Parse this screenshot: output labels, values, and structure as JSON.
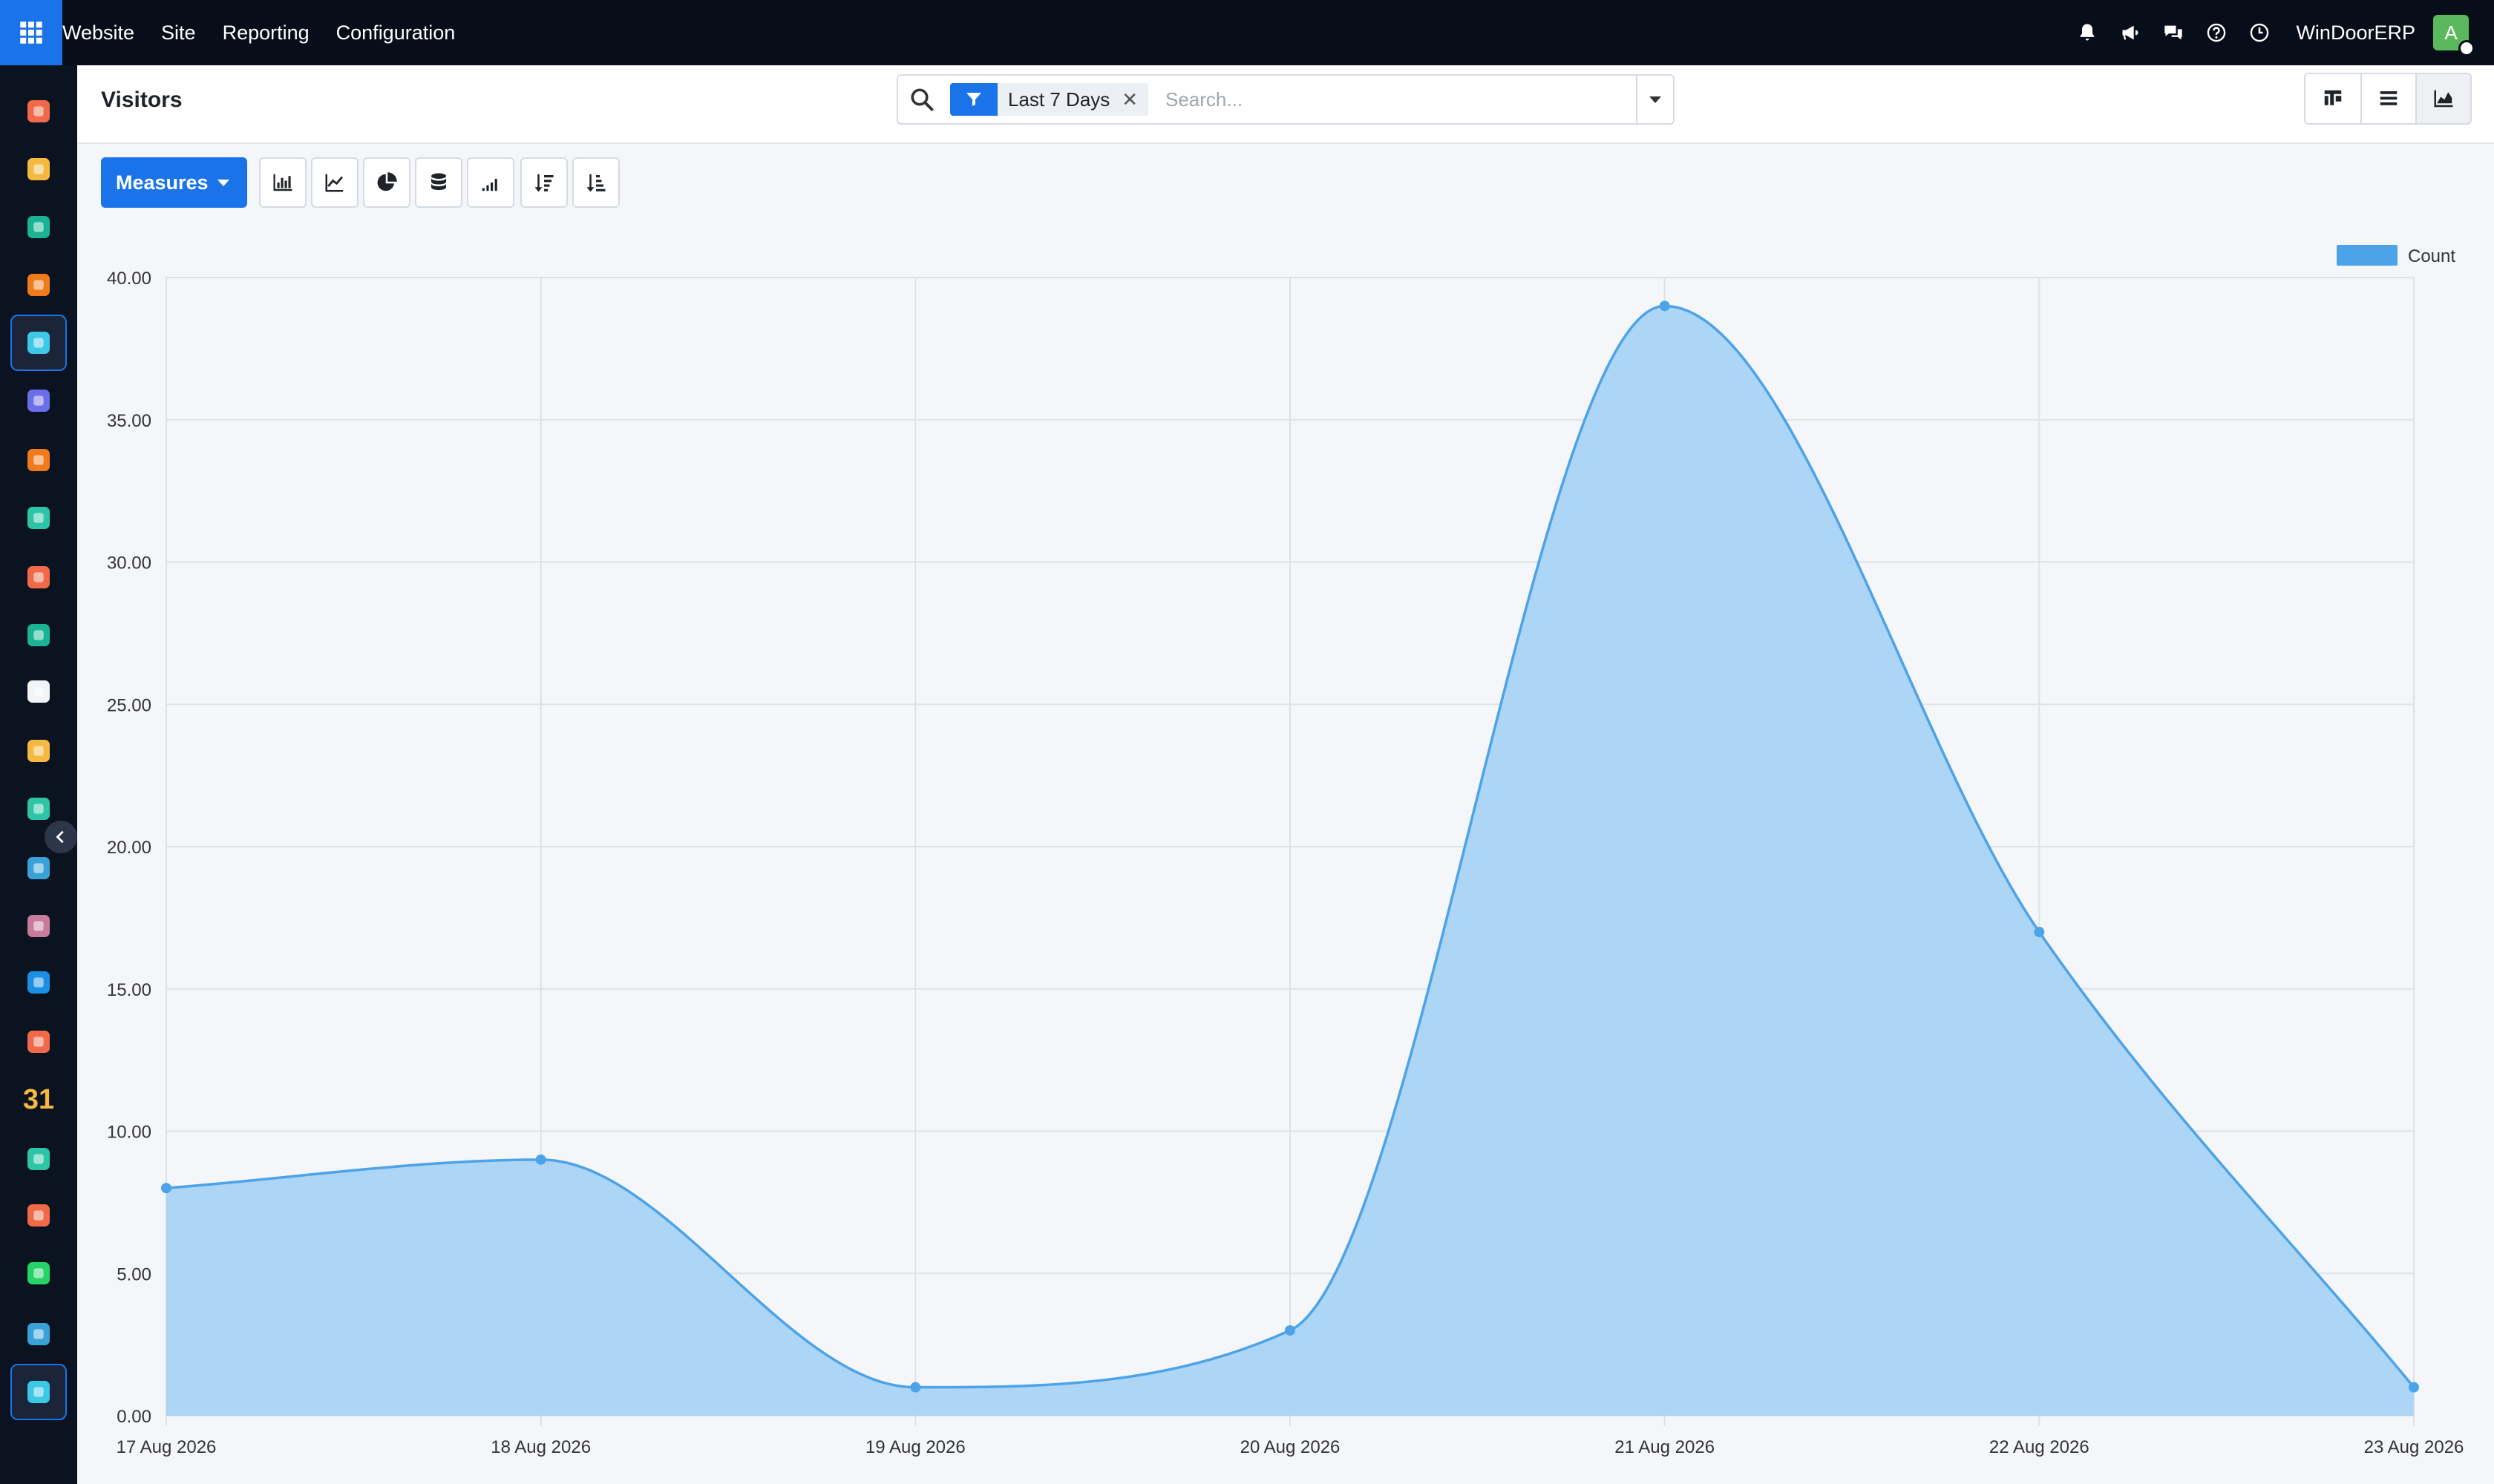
{
  "navbar": {
    "menu": [
      "Website",
      "Site",
      "Reporting",
      "Configuration"
    ],
    "company": "WinDoorERP",
    "avatar_letter": "A",
    "icons": [
      "bell-icon",
      "megaphone-icon",
      "chat-icon",
      "help-icon",
      "clock-icon"
    ]
  },
  "rail": {
    "apps": [
      {
        "name": "dashboards-app",
        "color": "#f06a4a"
      },
      {
        "name": "discuss-app",
        "color": "#f5b942"
      },
      {
        "name": "contacts-app",
        "color": "#1ab394"
      },
      {
        "name": "live-chat-app",
        "color": "#f07b1d"
      },
      {
        "name": "website-app",
        "color": "#3cc8e6",
        "active": true
      },
      {
        "name": "email-marketing-app",
        "color": "#6b6ee8"
      },
      {
        "name": "crm-app",
        "color": "#f07b1d"
      },
      {
        "name": "sales-app",
        "color": "#2ec4a6"
      },
      {
        "name": "reporting-app",
        "color": "#f06a4a"
      },
      {
        "name": "employees-app",
        "color": "#1ab394"
      },
      {
        "name": "inventory-app",
        "color": "#f2f4f7"
      },
      {
        "name": "notes-app",
        "color": "#f5b942"
      },
      {
        "name": "project-app",
        "color": "#2ec4a6"
      },
      {
        "name": "knowledge-app",
        "color": "#3aa0d8"
      },
      {
        "name": "products-app",
        "color": "#c97b9b"
      },
      {
        "name": "invoicing-app",
        "color": "#1a8fe3"
      },
      {
        "name": "team-app",
        "color": "#f06a4a"
      },
      {
        "name": "calendar-app",
        "color": "#f5b942",
        "label": "31"
      },
      {
        "name": "sign-app",
        "color": "#2ec4a6"
      },
      {
        "name": "apps-app",
        "color": "#f06a4a"
      },
      {
        "name": "whatsapp-app",
        "color": "#25d366"
      },
      {
        "name": "timer-app",
        "color": "#3aa0d8"
      },
      {
        "name": "website-app-active",
        "color": "#3cc8e6",
        "active": true
      }
    ]
  },
  "control": {
    "title": "Visitors",
    "facet_label": "Last 7 Days",
    "search_placeholder": "Search..."
  },
  "toolbar": {
    "measures_label": "Measures"
  },
  "colors": {
    "accent": "#1a73e8",
    "series_line": "#4ca3e8",
    "series_fill": "#a8d3f6"
  },
  "chart_data": {
    "type": "area",
    "x": [
      "17 Aug 2026",
      "18 Aug 2026",
      "19 Aug 2026",
      "20 Aug 2026",
      "21 Aug 2026",
      "22 Aug 2026",
      "23 Aug 2026"
    ],
    "series": [
      {
        "name": "Count",
        "values": [
          8,
          9,
          1,
          3,
          39,
          17,
          1
        ]
      }
    ],
    "ylim": [
      0,
      40
    ],
    "yticks": [
      "0.00",
      "5.00",
      "10.00",
      "15.00",
      "20.00",
      "25.00",
      "30.00",
      "35.00",
      "40.00"
    ],
    "grid": true,
    "legend": "top-right"
  }
}
